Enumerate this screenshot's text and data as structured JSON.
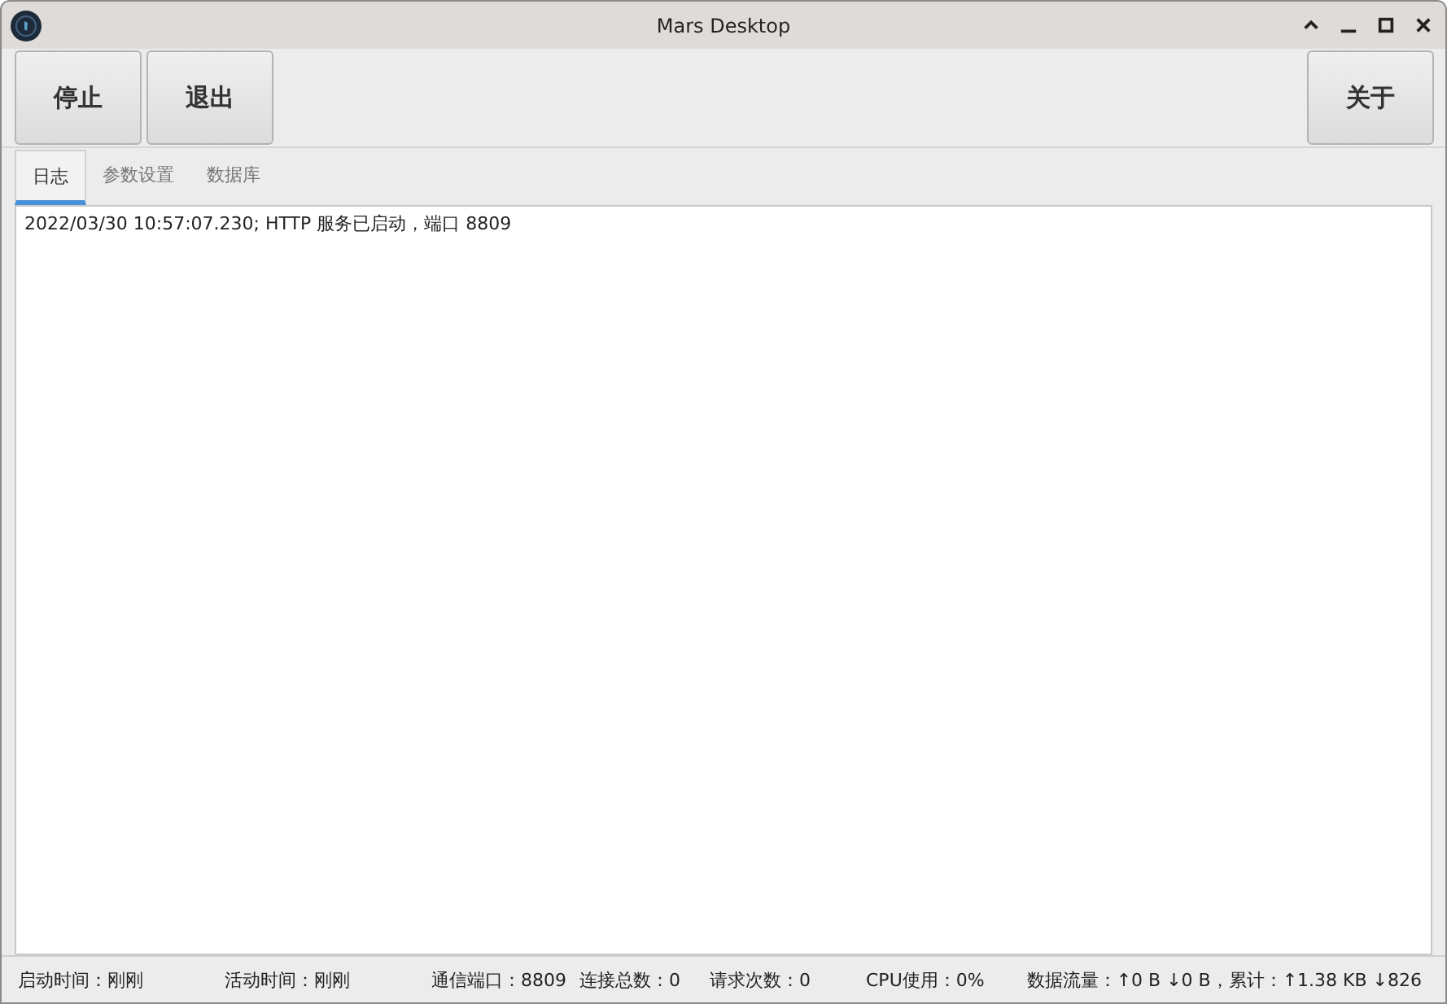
{
  "window": {
    "title": "Mars Desktop"
  },
  "toolbar": {
    "left_buttons": [
      "停止",
      "退出"
    ],
    "right_buttons": [
      "关于"
    ]
  },
  "tabs": [
    {
      "label": "日志",
      "selected": true
    },
    {
      "label": "参数设置",
      "selected": false
    },
    {
      "label": "数据库",
      "selected": false
    }
  ],
  "log": [
    "2022/03/30 10:57:07.230; HTTP 服务已启动，端口 8809"
  ],
  "status_bar": [
    "启动时间：刚刚",
    "活动时间：刚刚",
    "通信端口：8809",
    "连接总数：0",
    "请求次数：0",
    "CPU使用：0%",
    "数据流量：↑0 B ↓0 B，累计：↑1.38 KB ↓826"
  ]
}
